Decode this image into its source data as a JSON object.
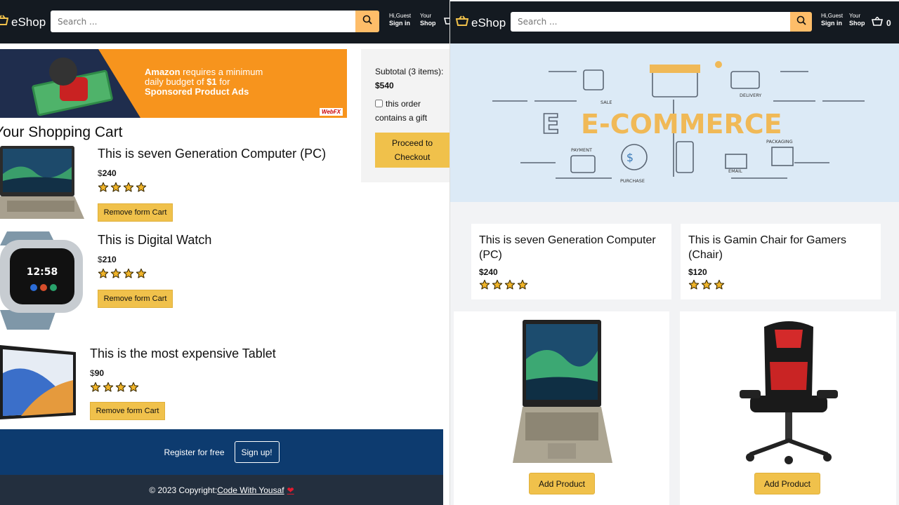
{
  "left": {
    "header": {
      "logo_text": "eShop",
      "search_placeholder": "Search ...",
      "greeting": "Hi,Guest",
      "sign_in": "Sign in",
      "your": "Your",
      "shop": "Shop"
    },
    "ad": {
      "line1_bold": "Amazon",
      "line1_rest": " requires a minimum",
      "line2a": "daily budget of ",
      "line2_bold": "$1",
      "line2b": " for",
      "line3": "Sponsored Product Ads",
      "brand": "WebFX"
    },
    "cart": {
      "title": "Your Shopping Cart",
      "items": [
        {
          "name": "This is seven Generation Computer (PC)",
          "currency": "$",
          "price": "240",
          "stars": 4,
          "remove_label": "Remove form Cart"
        },
        {
          "name": "This is Digital Watch",
          "currency": "$",
          "price": "210",
          "stars": 4,
          "remove_label": "Remove form Cart"
        },
        {
          "name": "This is the most expensive Tablet",
          "currency": "$",
          "price": "90",
          "stars": 4,
          "remove_label": "Remove form Cart"
        }
      ]
    },
    "subtotal": {
      "label": "Subtotal (3 items):",
      "amount": "$540",
      "gift_line1": "this order",
      "gift_line2": "contains a gift",
      "checkout_line1": "Proceed to",
      "checkout_line2": "Checkout"
    },
    "register": {
      "text": "Register for free",
      "button": "Sign up!"
    },
    "footer": {
      "copyright": "© 2023 Copyright:",
      "link": "Code With Yousaf",
      "heart": "❤"
    }
  },
  "right": {
    "header": {
      "logo_text": "eShop",
      "search_placeholder": "Search ...",
      "greeting": "Hi,Guest",
      "sign_in": "Sign in",
      "your": "Your",
      "shop": "Shop",
      "basket_count": "0"
    },
    "hero": {
      "title": "E-COMMERCE",
      "labels": {
        "sale": "SALE",
        "delivery": "DELIVERY",
        "payment": "PAYMENT",
        "packaging": "PACKAGING",
        "email": "EMAIL",
        "purchase": "PURCHASE"
      }
    },
    "products": [
      {
        "title": "This is seven Generation Computer (PC)",
        "price": "$240",
        "stars": 4,
        "add_label": "Add Product"
      },
      {
        "title": "This is Gamin Chair for Gamers (Chair)",
        "price": "$120",
        "stars": 3,
        "add_label": "Add Product"
      }
    ]
  },
  "colors": {
    "header_bg": "#141a21",
    "accent_yellow": "#f0c14b",
    "search_button": "#febd69",
    "register_bg": "#0d3b6f",
    "footer_bg": "#232f3e"
  }
}
